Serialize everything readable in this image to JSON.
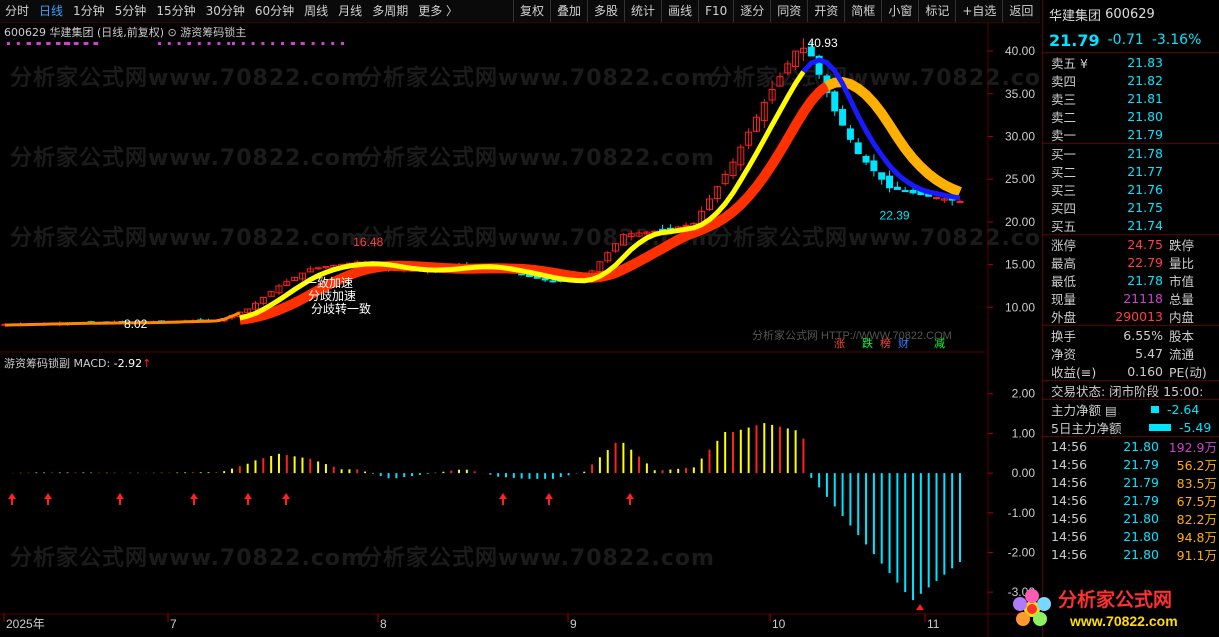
{
  "toolbar": {
    "periods": [
      "分时",
      "日线",
      "1分钟",
      "5分钟",
      "15分钟",
      "30分钟",
      "60分钟",
      "周线",
      "月线",
      "多周期",
      "更多 〉"
    ],
    "active_period": "日线",
    "buttons": [
      "复权",
      "叠加",
      "多股",
      "统计",
      "画线",
      "F10",
      "逐分",
      "同资",
      "开资",
      "简框",
      "小窗",
      "标记",
      "+自选",
      "返回"
    ]
  },
  "chart": {
    "title": "600629  华建集团 (日线,前复权)  ⊙  游资筹码锁主",
    "sub_title_prefix": "游资筹码锁副  MACD: ",
    "macd_value": "-2.92",
    "macd_arrow": "↑",
    "watermark_site": "分析家公式网 HTTP://WWW.70822.COM",
    "watermark_text": "分析家公式网www.70822.com",
    "annotations": {
      "high_label": "40.93",
      "low_label_after": "22.39",
      "peak_mid_label": "16.48",
      "low_label_left": "8.02",
      "signal_texts": [
        "一致加速",
        "分歧加速",
        "分歧转一致"
      ]
    },
    "event_badges": [
      "涨",
      "跌",
      "榜",
      "财",
      "减"
    ],
    "x_labels": [
      "2025年",
      "7",
      "8",
      "9",
      "10",
      "11"
    ],
    "y_main_ticks": [
      "40.00",
      "35.00",
      "30.00",
      "25.00",
      "20.00",
      "15.00",
      "10.00"
    ],
    "y_sub_ticks": [
      "2.00",
      "1.00",
      "0.00",
      "-1.00",
      "-2.00",
      "-3.00"
    ],
    "colors": {
      "up": "#ff2020",
      "down": "#00e5ff",
      "yellow": "#ffff00",
      "red_band": "#ff3000",
      "blue": "#1a1aff",
      "orange": "#ffb000"
    }
  },
  "chart_data": {
    "type": "candlestick",
    "y_range": [
      5,
      42
    ],
    "price_points": [
      {
        "m": "2025-06",
        "price": 8.0
      },
      {
        "m": "2025-07",
        "price": 8.3
      },
      {
        "m": "2025-07-end",
        "price": 9.5
      },
      {
        "m": "2025-08-mid",
        "price": 15.5
      },
      {
        "m": "2025-08-end",
        "price": 14.4
      },
      {
        "m": "2025-09-end",
        "price": 13.0
      },
      {
        "m": "2025-10-start",
        "price": 20.0
      },
      {
        "m": "2025-10-mid",
        "price": 40.93
      },
      {
        "m": "2025-11",
        "price": 22.39
      }
    ],
    "macd_range": [
      -3.5,
      2.8
    ]
  },
  "right_panel": {
    "name": "华建集团",
    "code": "600629",
    "price": "21.79",
    "change": "-0.71",
    "change_pct": "-3.16%",
    "asks": [
      {
        "label": "卖五 ¥",
        "price": "21.83"
      },
      {
        "label": "卖四",
        "price": "21.82"
      },
      {
        "label": "卖三",
        "price": "21.81"
      },
      {
        "label": "卖二",
        "price": "21.80"
      },
      {
        "label": "卖一",
        "price": "21.79"
      }
    ],
    "bids": [
      {
        "label": "买一",
        "price": "21.78"
      },
      {
        "label": "买二",
        "price": "21.77"
      },
      {
        "label": "买三",
        "price": "21.76"
      },
      {
        "label": "买四",
        "price": "21.75"
      },
      {
        "label": "买五",
        "price": "21.74"
      }
    ],
    "stats1": [
      {
        "l": "涨停",
        "v": "24.75",
        "c": "#ff4040",
        "l2": "跌停"
      },
      {
        "l": "最高",
        "v": "22.79",
        "c": "#ff4040",
        "l2": "量比"
      },
      {
        "l": "最低",
        "v": "21.78",
        "c": "#00e5ff",
        "l2": "市值"
      },
      {
        "l": "现量",
        "v": "21118",
        "c": "#d040d0",
        "l2": "总量"
      },
      {
        "l": "外盘",
        "v": "290013",
        "c": "#ff4040",
        "l2": "内盘"
      }
    ],
    "stats2": [
      {
        "l": "换手",
        "v": "6.55%",
        "c": "#ccc",
        "l2": "股本"
      },
      {
        "l": "净资",
        "v": "5.47",
        "c": "#ccc",
        "l2": "流通"
      },
      {
        "l": "收益(≡)",
        "v": "0.160",
        "c": "#ccc",
        "l2": "PE(动)"
      }
    ],
    "trade_status": "交易状态: 闭市阶段  15:00:",
    "main_flow": [
      {
        "label": "主力净额 ▤",
        "value": "-2.64"
      },
      {
        "label": "5日主力净额",
        "value": "-5.49"
      }
    ],
    "ticks": [
      {
        "t": "14:56",
        "p": "21.80",
        "v": "192.9万",
        "c": "#d040d0"
      },
      {
        "t": "14:56",
        "p": "21.79",
        "v": "56.2万",
        "c": "#ffb000"
      },
      {
        "t": "14:56",
        "p": "21.79",
        "v": "83.5万",
        "c": "#ffb000"
      },
      {
        "t": "14:56",
        "p": "21.79",
        "v": "67.5万",
        "c": "#ffb000"
      },
      {
        "t": "14:56",
        "p": "21.80",
        "v": "82.2万",
        "c": "#ffb000"
      },
      {
        "t": "14:56",
        "p": "21.80",
        "v": "94.8万",
        "c": "#ffb000"
      },
      {
        "t": "14:56",
        "p": "21.80",
        "v": "91.1万",
        "c": "#ffb000"
      }
    ],
    "logo_text": "分析家公式网",
    "logo_url": "www.70822.com"
  }
}
